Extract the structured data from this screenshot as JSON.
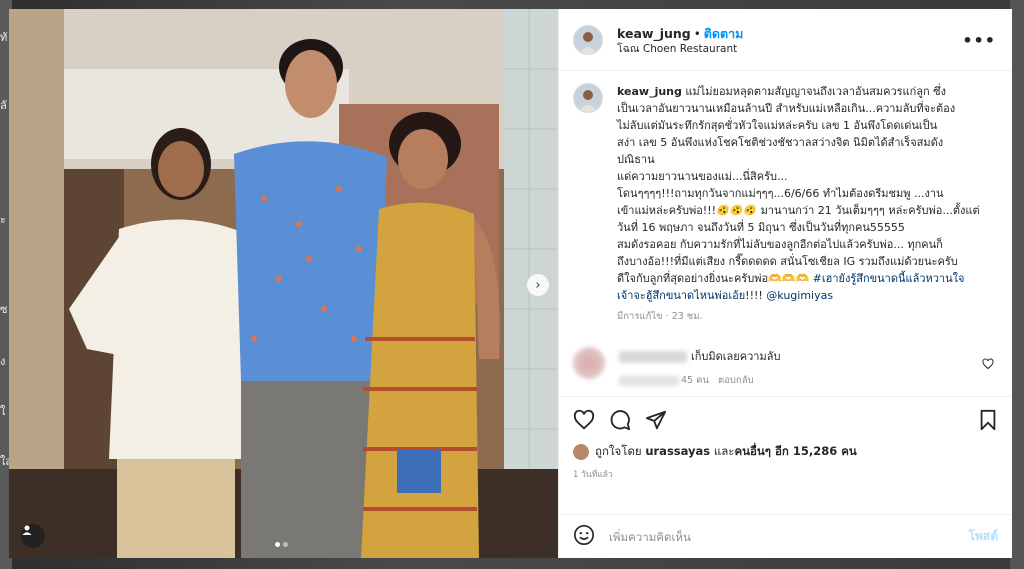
{
  "header": {
    "username": "keaw_jung",
    "separator": "•",
    "follow_label": "ติดตาม",
    "location": "โฉณ Choen Restaurant",
    "more_glyph": "•••"
  },
  "caption": {
    "username": "keaw_jung",
    "lines": [
      "แม่ไม่ยอมหลุดตามสัญญาจนถึงเวลาอันสมควรแก่ลูก ซึ่ง",
      "เป็นเวลาอันยาวนานเหมือนล้านปี สำหรับแม่เหลือเกิน...ความลับที่จะต้อง",
      "ไม่ลับแต่มันระทึกรักสุดชั่วหัวใจแม่หล่ะครับ เลข 1 อันพึงโดดเด่นเป็น",
      "สง่า เลข 5 อันพึงแห่งโชคโชติช่วงชัชวาลสว่างจิต นิมิตได้สำเร็จสมดัง",
      "ปณิธาน",
      "แด่ความยาวนานของแม่...นี่สิครับ...",
      "โดนๆๆๆๆ!!!ถามทุกวันจากแม่ๆๆๆ...6/6/66 ทำไมต้องดรีมชมพู ...งาน",
      "เข้าแม่หล่ะครับพ่อ!!!🫨🫨🫨 มานานกว่า 21 วันเต็มๆๆๆ หล่ะครับพ่อ...ตั้งแต่",
      "วันที่ 16 พฤษภา จนถึงวันที่ 5 มิถุนา ซึ่งเป็นวันที่ทุกคน55555",
      "สมดังรอคอย กับความรักที่ไม่ลับของลูกอีกต่อไปแล้วครับพ่อ... ทุกคนก็",
      "ถึงบางอ้อ!!!ที่มีแต่เสียง กรี๊ดดดดด สนั่นโซเชียล IG รวมถึงแม่ด้วยนะครับ",
      "ดีใจกับลูกที่สุดอย่างยิ่งนะครับพ่อ🫶🫶🫶"
    ],
    "hashtag_1": "#เฮายังรู้สึกขนาดนี้แล้วหวานใจ",
    "hashtag_2": "เจ้าจะฮู้สึกขนาดไหนพ่อเอ้ย",
    "trail": "!!!! ",
    "mention": "@kugimiyas",
    "edited": "มีการแก้ไข",
    "dot": "·",
    "time": "23 ชม."
  },
  "comment": {
    "text": "เก็บมิดเลยความลับ",
    "likes": "45 คน",
    "reply": "ตอบกลับ"
  },
  "likes": {
    "prefix": "ถูกใจโดย",
    "user": "urassayas",
    "middle": "และ",
    "others": "คนอื่นๆ อีก 15,286 คน"
  },
  "posted_ago": "1 วันที่แล้ว",
  "add_comment": {
    "placeholder": "เพิ่มความคิดเห็น",
    "post_label": "โพสต์"
  },
  "photo": {
    "next_glyph": "›"
  },
  "backdrop": {
    "edge_glyphs": [
      "ทั",
      "ลั",
      "ะ",
      "ซ",
      "ง",
      "ใ",
      "ใส"
    ]
  },
  "colors": {
    "accent": "#0095f6",
    "hashtag": "#00376b",
    "post_disabled": "#b2dffc"
  }
}
